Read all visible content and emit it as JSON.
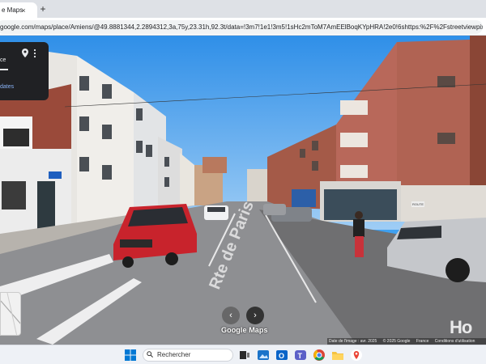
{
  "browser": {
    "tab_title": "e Maps",
    "tab_close": "×",
    "new_tab": "+",
    "url": "google.com/maps/place/Amiens/@49.8881344,2.2894312,3a,75y,23.31h,92.3t/data=!3m7!1e1!3m5!1sHc2mToM7AmEElBoqKYpHRA!2e0!6shttps:%2F%2Fstreetviewpixels-pa.googleapis.c..."
  },
  "info_card": {
    "place_fragment": "ce",
    "dates_fragment": "dates"
  },
  "street_sign": "Rte de Paris",
  "sign_small": "ROUTE",
  "nav": {
    "left": "‹",
    "right": "›"
  },
  "logo": "Google Maps",
  "attribution": {
    "date": "Date de l'image : avr. 2025",
    "copyright": "© 2025 Google",
    "region": "France",
    "terms": "Conditions d'utilisation"
  },
  "watermark": "Ho",
  "taskbar": {
    "search_label": "Rechercher",
    "icons": [
      "windows-start",
      "search",
      "task-view",
      "photos",
      "outlook",
      "teams",
      "chrome",
      "file-explorer",
      "maps-pin"
    ]
  },
  "colors": {
    "sky": "#3fa0f0",
    "car_red": "#c8232c",
    "brick": "#9a4a3a",
    "taskbar": "#eef1f6"
  }
}
